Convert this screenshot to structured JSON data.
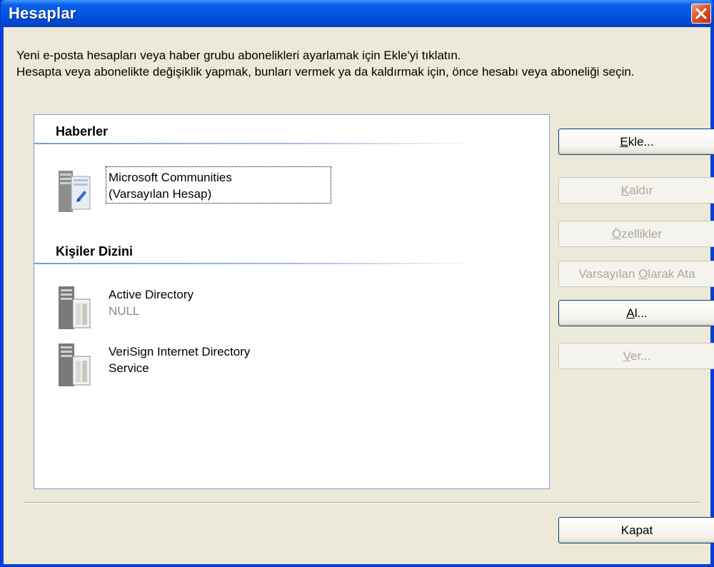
{
  "window": {
    "title": "Hesaplar",
    "close_icon": "close-icon"
  },
  "intro": {
    "line1": "Yeni e-posta hesapları veya haber grubu abonelikleri ayarlamak için Ekle'yi tıklatın.",
    "line2": "Hesapta veya abonelikte değişiklik yapmak, bunları vermek ya da kaldırmak için, önce hesabı veya aboneliği seçin."
  },
  "sections": [
    {
      "title": "Haberler",
      "items": [
        {
          "name": "Microsoft Communities",
          "sub": "(Varsayılan Hesap)",
          "icon": "news-account-icon",
          "selected": true
        }
      ]
    },
    {
      "title": "Kişiler Dizini",
      "items": [
        {
          "name": "Active Directory",
          "sub": "NULL",
          "icon": "directory-server-icon"
        },
        {
          "name": "VeriSign Internet Directory",
          "name2": "Service",
          "icon": "directory-server-icon"
        }
      ]
    }
  ],
  "buttons": {
    "add": {
      "pre": "",
      "u": "E",
      "post": "kle...",
      "enabled": true
    },
    "remove": {
      "pre": "",
      "u": "K",
      "post": "aldır",
      "enabled": false
    },
    "properties": {
      "pre": "",
      "u": "Ö",
      "post": "zellikler",
      "enabled": false
    },
    "set_default": {
      "pre": "Varsayılan ",
      "u": "O",
      "post": "larak Ata",
      "enabled": false
    },
    "import": {
      "pre": "",
      "u": "A",
      "post": "l...",
      "enabled": true
    },
    "export": {
      "pre": "",
      "u": "V",
      "post": "er...",
      "enabled": false
    },
    "close": {
      "label": "Kapat",
      "enabled": true
    }
  },
  "colors": {
    "titlebar": "#0054e3",
    "client": "#ece9d8",
    "disabled_text": "#aca899"
  }
}
